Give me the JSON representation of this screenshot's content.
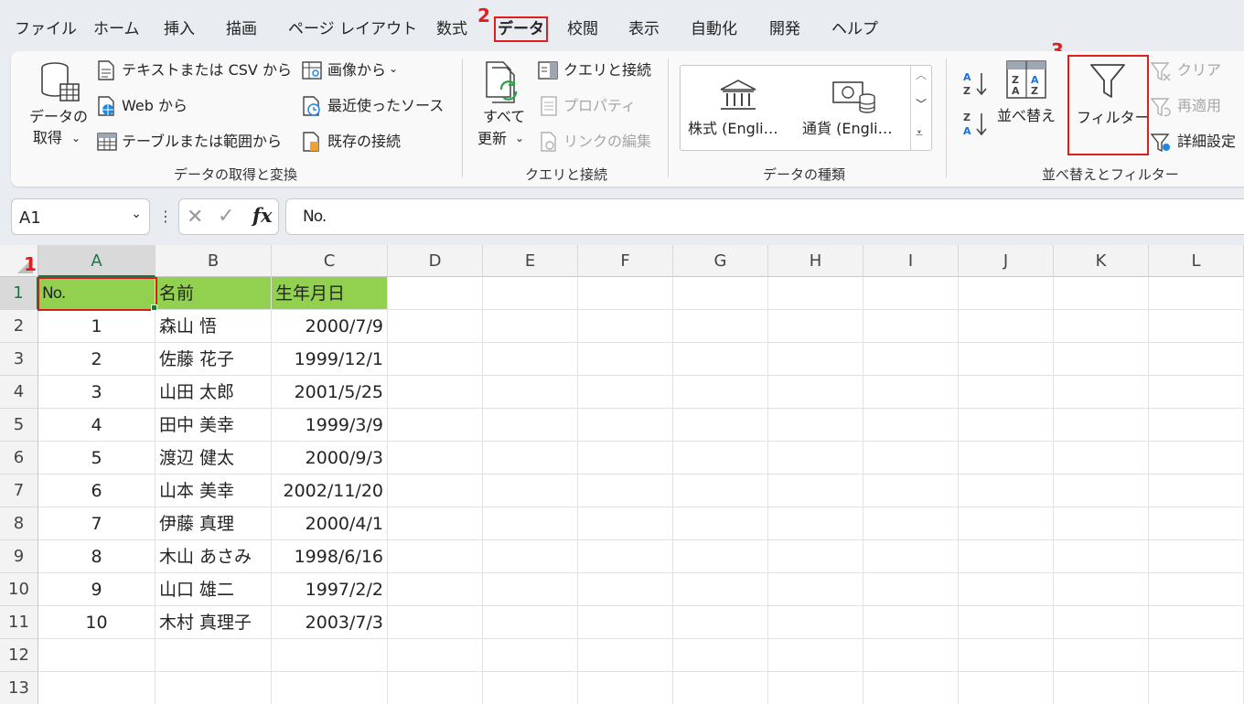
{
  "menu": {
    "tabs": [
      "ファイル",
      "ホーム",
      "挿入",
      "描画",
      "ページ レイアウト",
      "数式",
      "データ",
      "校閲",
      "表示",
      "自動化",
      "開発",
      "ヘルプ"
    ]
  },
  "steps": [
    "1",
    "2",
    "3"
  ],
  "ribbon": {
    "get_data": {
      "line1": "データの",
      "line2": "取得",
      "text_csv": "テキストまたは CSV から",
      "web": "Web から",
      "table_range": "テーブルまたは範囲から",
      "from_image": "画像から",
      "recent_sources": "最近使ったソース",
      "existing_connections": "既存の接続",
      "group_label": "データの取得と変換"
    },
    "queries": {
      "refresh_line1": "すべて",
      "refresh_line2": "更新",
      "queries_connections": "クエリと接続",
      "properties": "プロパティ",
      "edit_links": "リンクの編集",
      "group_label": "クエリと接続"
    },
    "data_types": {
      "stocks": "株式 (Engli…",
      "currencies": "通貨 (Engli…",
      "group_label": "データの種類"
    },
    "sort_filter": {
      "sort": "並べ替え",
      "filter": "フィルター",
      "clear": "クリア",
      "reapply": "再適用",
      "advanced": "詳細設定",
      "group_label": "並べ替えとフィルター"
    }
  },
  "formula_bar": {
    "name_box": "A1",
    "content": "No."
  },
  "grid": {
    "columns": [
      "A",
      "B",
      "C",
      "D",
      "E",
      "F",
      "G",
      "H",
      "I",
      "J",
      "K",
      "L"
    ],
    "rows": [
      "1",
      "2",
      "3",
      "4",
      "5",
      "6",
      "7",
      "8",
      "9",
      "10",
      "11",
      "12",
      "13"
    ],
    "header": [
      "No.",
      "名前",
      "生年月日"
    ],
    "data": [
      [
        "1",
        "森山 悟",
        "2000/7/9"
      ],
      [
        "2",
        "佐藤 花子",
        "1999/12/1"
      ],
      [
        "3",
        "山田 太郎",
        "2001/5/25"
      ],
      [
        "4",
        "田中 美幸",
        "1999/3/9"
      ],
      [
        "5",
        "渡辺 健太",
        "2000/9/3"
      ],
      [
        "6",
        "山本 美幸",
        "2002/11/20"
      ],
      [
        "7",
        "伊藤 真理",
        "2000/4/1"
      ],
      [
        "8",
        "木山 あさみ",
        "1998/6/16"
      ],
      [
        "9",
        "山口 雄二",
        "1997/2/2"
      ],
      [
        "10",
        "木村 真理子",
        "2003/7/3"
      ]
    ]
  },
  "colors": {
    "header_fill": "#92d050",
    "highlight": "#e01e1e",
    "excel_green": "#217346"
  }
}
